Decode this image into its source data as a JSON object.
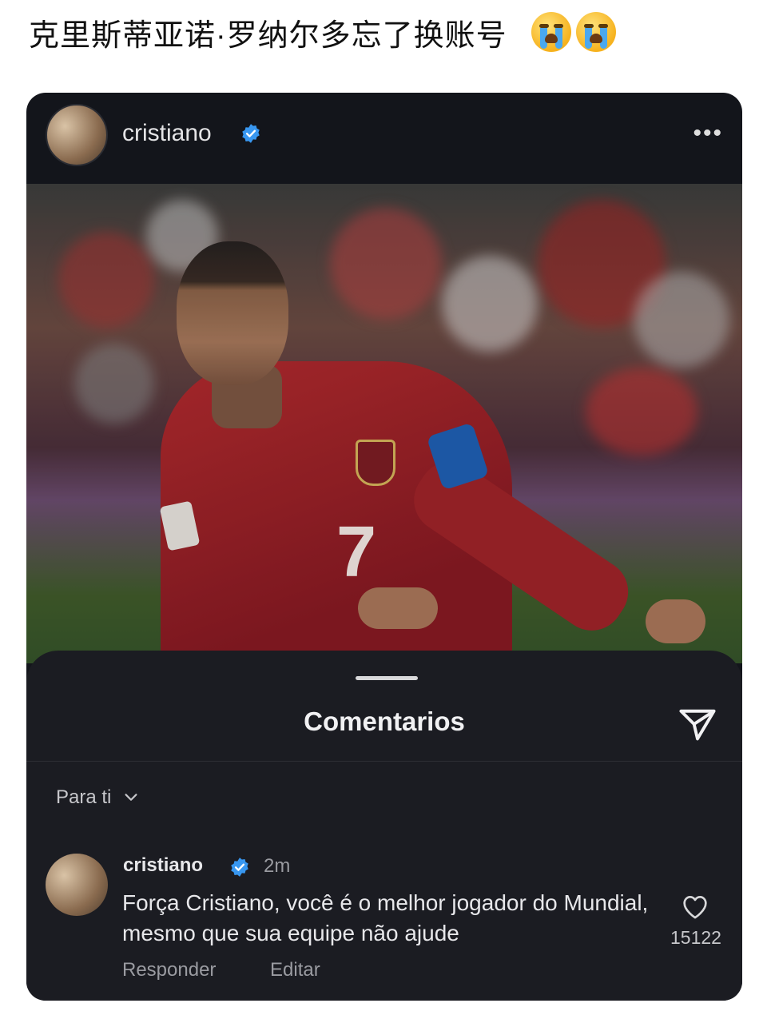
{
  "post": {
    "title": "克里斯蒂亚诺·罗纳尔多忘了换账号"
  },
  "instagram": {
    "header": {
      "username": "cristiano",
      "more": "•••"
    },
    "photo": {
      "jersey_number": "7"
    },
    "comments_sheet": {
      "title": "Comentarios",
      "filter_label": "Para ti",
      "comment": {
        "username": "cristiano",
        "time": "2m",
        "text": "Força Cristiano, você é o melhor jogador do Mundial, mesmo que sua equipe não ajude",
        "likes": "15122",
        "reply_label": "Responder",
        "edit_label": "Editar"
      }
    }
  },
  "colors": {
    "background": "#13151b",
    "sheet": "#1b1c22",
    "verified": "#3897f0"
  },
  "icons": [
    "crying-face-icon",
    "verified-badge-icon",
    "more-icon",
    "share-icon",
    "chevron-down-icon",
    "heart-icon"
  ]
}
